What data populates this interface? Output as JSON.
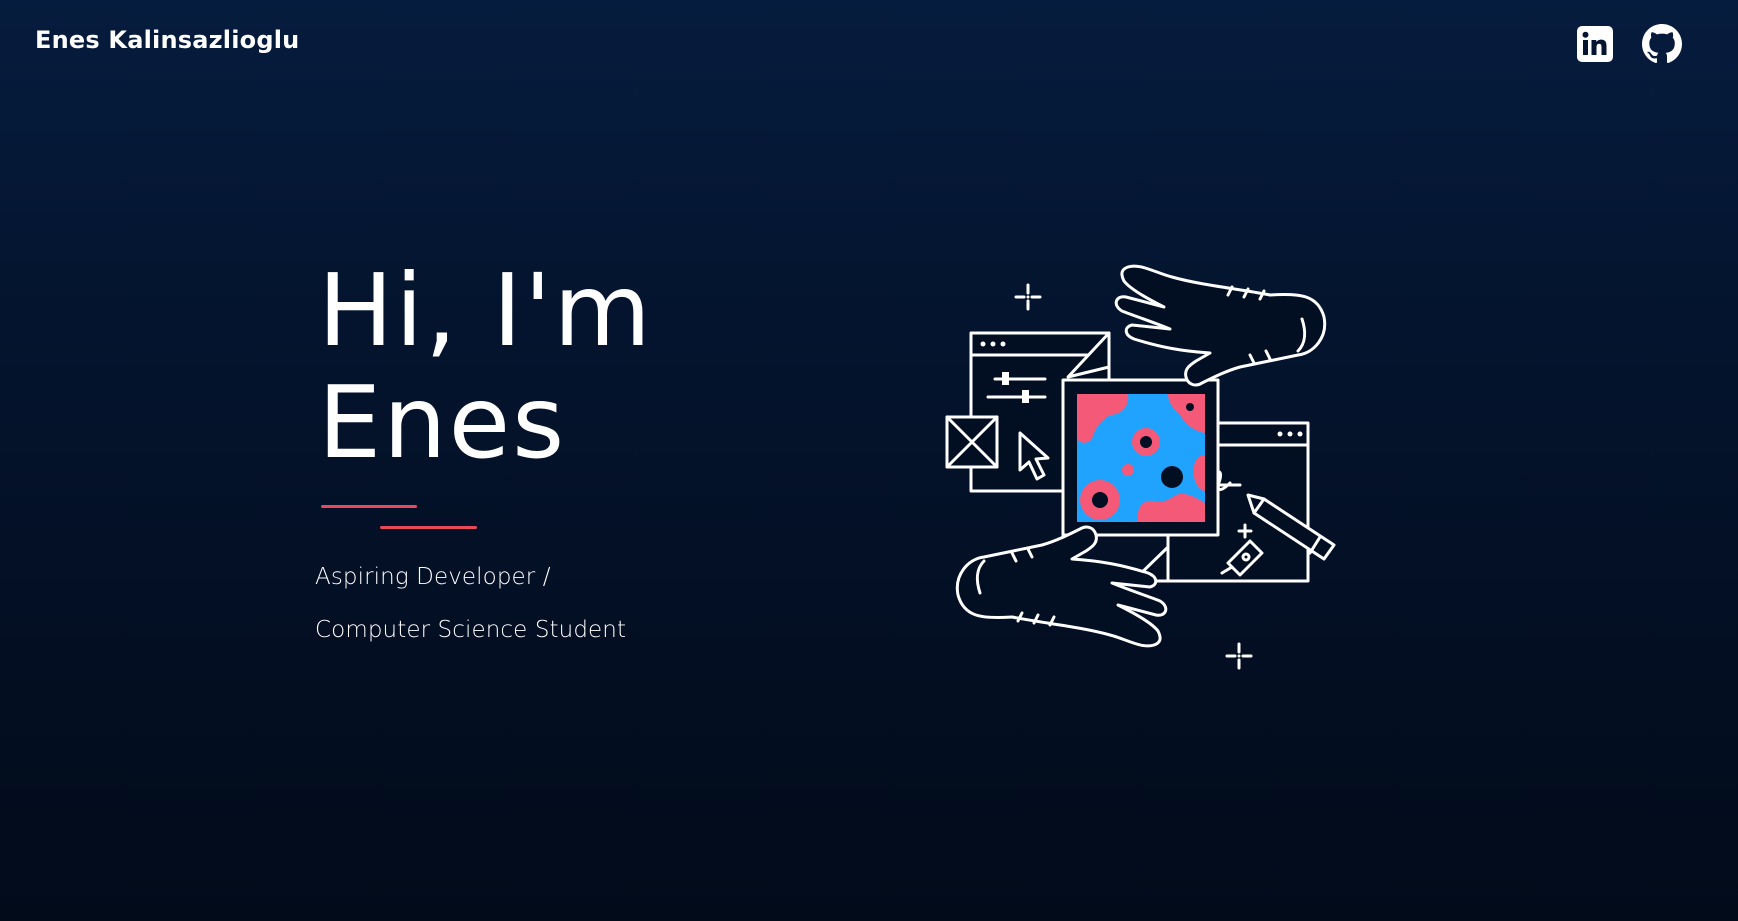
{
  "header": {
    "brand": "Enes Kalinsazlioglu",
    "social": [
      {
        "name": "LinkedIn",
        "icon": "linkedin-icon"
      },
      {
        "name": "GitHub",
        "icon": "github-icon"
      }
    ]
  },
  "hero": {
    "title_line1": "Hi, I'm",
    "title_line2": "Enes",
    "subtitle_line1": "Aspiring Developer /",
    "subtitle_line2": "Computer Science Student",
    "illustration_icon": "creative-hands-windows-illustration"
  },
  "colors": {
    "background_top": "#061c3e",
    "background_bottom": "#020b1a",
    "accent_red": "#e9475a",
    "illustration_pink": "#f45a78",
    "illustration_blue": "#1fa3ff",
    "text": "#ffffff"
  }
}
